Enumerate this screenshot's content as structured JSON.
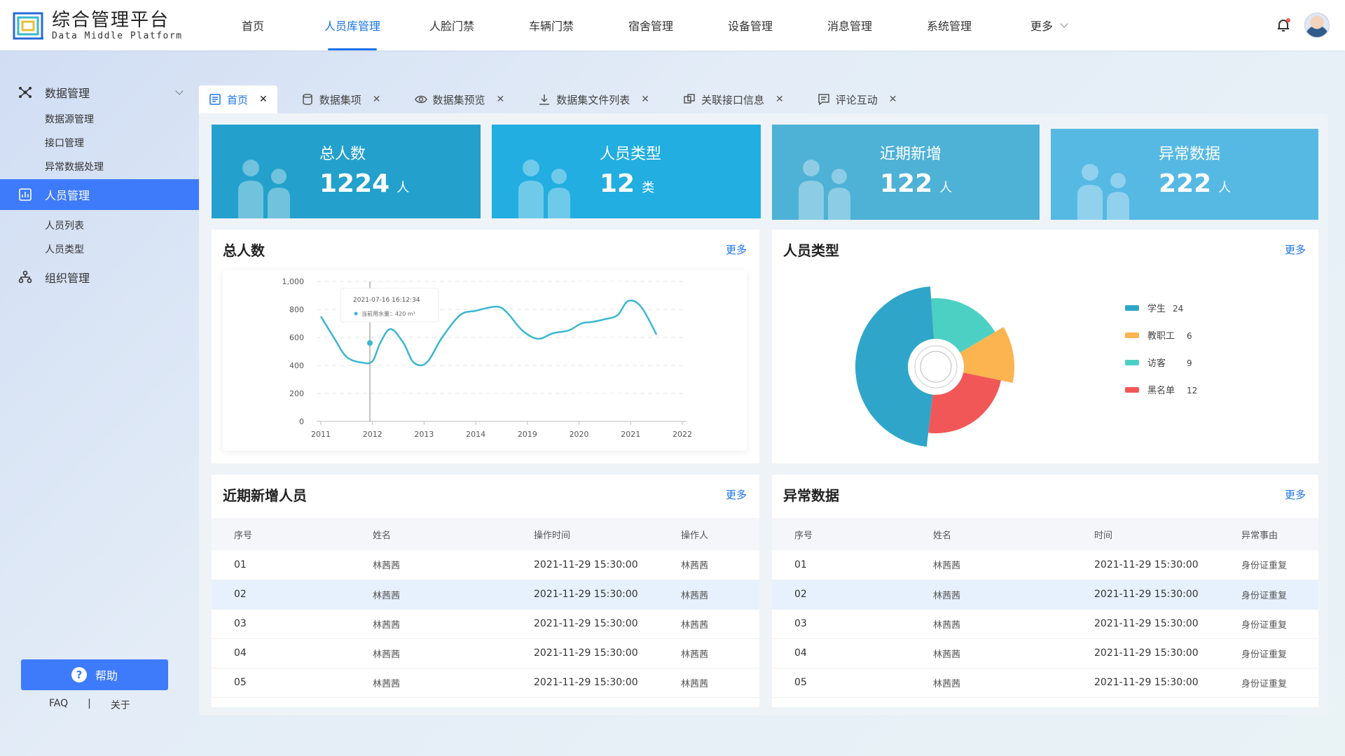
{
  "brand": {
    "title": "综合管理平台",
    "subtitle": "Data Middle Platform"
  },
  "topnav": [
    {
      "label": "首页",
      "active": false
    },
    {
      "label": "人员库管理",
      "active": true
    },
    {
      "label": "人脸门禁",
      "active": false
    },
    {
      "label": "车辆门禁",
      "active": false
    },
    {
      "label": "宿舍管理",
      "active": false
    },
    {
      "label": "设备管理",
      "active": false
    },
    {
      "label": "消息管理",
      "active": false
    },
    {
      "label": "系统管理",
      "active": false
    },
    {
      "label": "更多",
      "active": false
    }
  ],
  "sidebar": {
    "group1": {
      "label": "数据管理",
      "items": [
        "数据源管理",
        "接口管理",
        "异常数据处理"
      ]
    },
    "group2": {
      "label": "人员管理",
      "items": [
        "人员列表",
        "人员类型"
      ]
    },
    "group3": {
      "label": "组织管理"
    },
    "help": "帮助",
    "faq": "FAQ",
    "sep": "|",
    "about": "关于"
  },
  "tabs": [
    {
      "label": "首页",
      "icon": "document-icon",
      "active": true
    },
    {
      "label": "数据集项",
      "icon": "database-icon",
      "active": false
    },
    {
      "label": "数据集预览",
      "icon": "eye-icon",
      "active": false
    },
    {
      "label": "数据集文件列表",
      "icon": "download-icon",
      "active": false
    },
    {
      "label": "关联接口信息",
      "icon": "link-icon",
      "active": false
    },
    {
      "label": "评论互动",
      "icon": "comment-icon",
      "active": false
    }
  ],
  "stats": [
    {
      "title": "总人数",
      "value": "1224",
      "unit": "人",
      "color": "#23a1cc"
    },
    {
      "title": "人员类型",
      "value": "12",
      "unit": "类",
      "color": "#22aee0"
    },
    {
      "title": "近期新增",
      "value": "122",
      "unit": "人",
      "color": "#4eb1d6"
    },
    {
      "title": "异常数据",
      "value": "222",
      "unit": "人",
      "color": "#56b9e4"
    }
  ],
  "line_panel": {
    "title": "总人数",
    "more": "更多"
  },
  "pie_panel": {
    "title": "人员类型",
    "more": "更多"
  },
  "recent_panel": {
    "title": "近期新增人员",
    "more": "更多"
  },
  "abnormal_panel": {
    "title": "异常数据",
    "more": "更多"
  },
  "tooltip": {
    "time": "2021-07-16 16:12:34",
    "label": "当前用水量：420 m³"
  },
  "chart_data": [
    {
      "type": "line",
      "x": [
        "2011",
        "2012",
        "2013",
        "2014",
        "2019",
        "2020",
        "2021",
        "2022"
      ],
      "yticks": [
        "0",
        "200",
        "400",
        "600",
        "800",
        "1,000"
      ],
      "ylim": [
        0,
        1000
      ],
      "series": [
        {
          "points": [
            [
              0.0,
              750
            ],
            [
              0.25,
              600
            ],
            [
              0.5,
              460
            ],
            [
              0.8,
              420
            ],
            [
              1.0,
              430
            ],
            [
              1.15,
              560
            ],
            [
              1.35,
              660
            ],
            [
              1.6,
              560
            ],
            [
              1.8,
              420
            ],
            [
              2.05,
              420
            ],
            [
              2.35,
              600
            ],
            [
              2.7,
              760
            ],
            [
              3.0,
              790
            ],
            [
              3.4,
              820
            ],
            [
              3.6,
              780
            ],
            [
              3.9,
              650
            ],
            [
              4.2,
              590
            ],
            [
              4.5,
              630
            ],
            [
              4.8,
              650
            ],
            [
              5.05,
              700
            ],
            [
              5.25,
              710
            ],
            [
              5.5,
              730
            ],
            [
              5.75,
              760
            ],
            [
              5.95,
              860
            ],
            [
              6.2,
              820
            ],
            [
              6.5,
              620
            ]
          ],
          "color": "#3bb7cf"
        }
      ],
      "grid": true
    },
    {
      "type": "pie",
      "slices": [
        {
          "label": "学生",
          "value": 24,
          "color": "#2fa6c9",
          "legend_value": "24"
        },
        {
          "label": "教职工",
          "value": 6,
          "color": "#fbb450",
          "legend_value": "6"
        },
        {
          "label": "访客",
          "value": 9,
          "color": "#4dd0c4",
          "legend_value": "9"
        },
        {
          "label": "黑名单",
          "value": 12,
          "color": "#f25757",
          "legend_value": "12"
        }
      ]
    }
  ],
  "recent_table": {
    "headers": [
      "序号",
      "姓名",
      "操作时间",
      "操作人"
    ],
    "rows": [
      [
        "01",
        "林茜茜",
        "2021-11-29 15:30:00",
        "林茜茜"
      ],
      [
        "02",
        "林茜茜",
        "2021-11-29 15:30:00",
        "林茜茜"
      ],
      [
        "03",
        "林茜茜",
        "2021-11-29 15:30:00",
        "林茜茜"
      ],
      [
        "04",
        "林茜茜",
        "2021-11-29 15:30:00",
        "林茜茜"
      ],
      [
        "05",
        "林茜茜",
        "2021-11-29 15:30:00",
        "林茜茜"
      ]
    ]
  },
  "abnormal_table": {
    "headers": [
      "序号",
      "姓名",
      "时间",
      "异常事由"
    ],
    "rows": [
      [
        "01",
        "林茜茜",
        "2021-11-29 15:30:00",
        "身份证重复"
      ],
      [
        "02",
        "林茜茜",
        "2021-11-29 15:30:00",
        "身份证重复"
      ],
      [
        "03",
        "林茜茜",
        "2021-11-29 15:30:00",
        "身份证重复"
      ],
      [
        "04",
        "林茜茜",
        "2021-11-29 15:30:00",
        "身份证重复"
      ],
      [
        "05",
        "林茜茜",
        "2021-11-29 15:30:00",
        "身份证重复"
      ]
    ]
  }
}
